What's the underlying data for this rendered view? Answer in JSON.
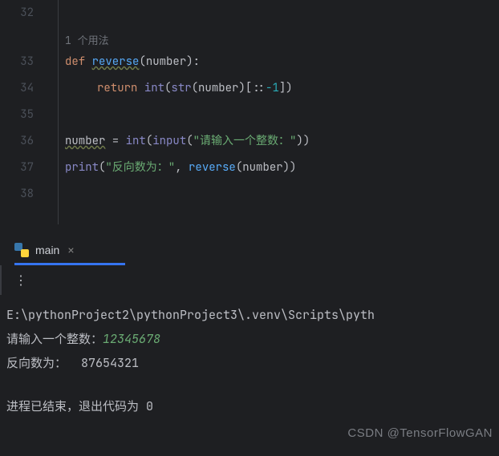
{
  "editor": {
    "hint": "1 个用法",
    "lines": {
      "32": "32",
      "33": "33",
      "34": "34",
      "35": "35",
      "36": "36",
      "37": "37",
      "38": "38"
    },
    "code": {
      "def": "def",
      "reverse": "reverse",
      "params_open": "(",
      "param_number": "number",
      "params_close": "):",
      "return": "return",
      "int": "int",
      "str": "str",
      "slice_open": "(",
      "slice_mid": ")[::",
      "neg1": "-1",
      "slice_close": "])",
      "number_var": "number",
      "assign": " = ",
      "input": "input",
      "prompt_str": "\"请输入一个整数：\"",
      "close2": "))",
      "print": "print",
      "out_str": "\"反向数为：\"",
      "comma": ", ",
      "close1": "))"
    }
  },
  "tab": {
    "label": "main",
    "close": "×"
  },
  "toolbar": {
    "menu": "⋮"
  },
  "terminal": {
    "path": "E:\\pythonProject2\\pythonProject3\\.venv\\Scripts\\pyth",
    "prompt": "请输入一个整数：",
    "input": "12345678",
    "output_label": "反向数为：  ",
    "output_value": "87654321",
    "exit_msg": "进程已结束，退出代码为 ",
    "exit_code": "0"
  },
  "watermark": "CSDN @TensorFlowGAN"
}
